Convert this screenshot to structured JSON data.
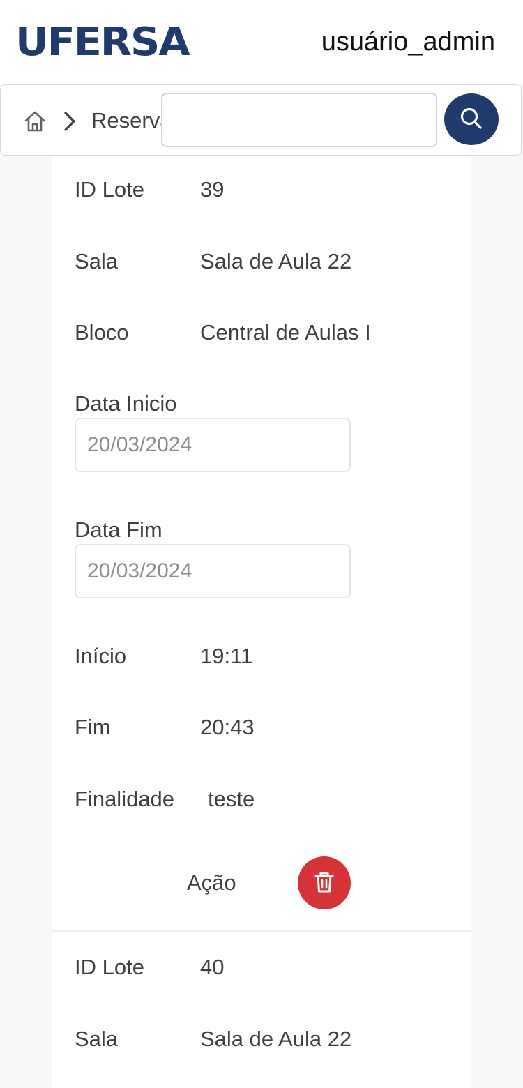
{
  "header": {
    "logo_text": "UFERSA",
    "username": "usuário_admin"
  },
  "breadcrumb": {
    "home_icon": "home-icon",
    "separator_icon": "chevron-right-icon",
    "current": "Reservas de"
  },
  "search": {
    "value": "",
    "button_icon": "search-icon"
  },
  "records": [
    {
      "id_lote_label": "ID Lote",
      "id_lote": "39",
      "sala_label": "Sala",
      "sala": "Sala de Aula 22",
      "bloco_label": "Bloco",
      "bloco": "Central de Aulas I",
      "data_inicio_label": "Data Inicio",
      "data_inicio": "20/03/2024",
      "data_fim_label": "Data Fim",
      "data_fim": "20/03/2024",
      "inicio_label": "Início",
      "inicio": "19:11",
      "fim_label": "Fim",
      "fim": "20:43",
      "finalidade_label": "Finalidade",
      "finalidade": "teste",
      "acao_label": "Ação",
      "delete_icon": "trash-icon"
    },
    {
      "id_lote_label": "ID Lote",
      "id_lote": "40",
      "sala_label": "Sala",
      "sala": "Sala de Aula 22"
    }
  ],
  "colors": {
    "brand": "#1f3a6b",
    "danger": "#d63339",
    "page_bg": "#f7f8fa"
  }
}
